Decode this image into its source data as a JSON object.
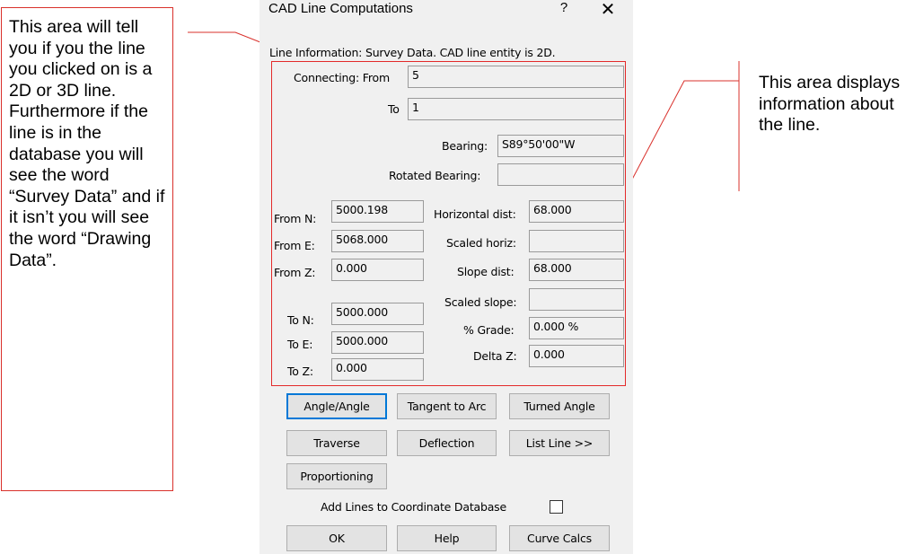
{
  "left_callout": {
    "text": "This area will tell you if you the line you clicked on is a 2D or 3D line. Furthermore if the line is in the database you will see the word “Survey Data” and if it isn’t you will see the word “Drawing Data”."
  },
  "right_callout": {
    "text": "This area displays information about the line."
  },
  "dialog": {
    "title": "CAD Line Computations",
    "help_glyph": "?",
    "close_glyph": "✕",
    "line_info": "Line Information: Survey Data. CAD line entity is 2D.",
    "connecting_from_label": "Connecting: From",
    "connecting_from_value": "5",
    "to_label": "To",
    "to_value": "1",
    "bearing_label": "Bearing:",
    "bearing_value": "S89°50'00\"W",
    "rotated_bearing_label": "Rotated Bearing:",
    "rotated_bearing_value": "",
    "from_n_label": "From N:",
    "from_n_value": "5000.198",
    "from_e_label": "From E:",
    "from_e_value": "5068.000",
    "from_z_label": "From Z:",
    "from_z_value": "0.000",
    "to_n_label": "To N:",
    "to_n_value": "5000.000",
    "to_e_label": "To E:",
    "to_e_value": "5000.000",
    "to_z_label": "To Z:",
    "to_z_value": "0.000",
    "horizontal_dist_label": "Horizontal dist:",
    "horizontal_dist_value": "68.000",
    "scaled_horiz_label": "Scaled horiz:",
    "scaled_horiz_value": "",
    "slope_dist_label": "Slope dist:",
    "slope_dist_value": "68.000",
    "scaled_slope_label": "Scaled slope:",
    "scaled_slope_value": "",
    "grade_label": "% Grade:",
    "grade_value": "0.000 %",
    "delta_z_label": "Delta Z:",
    "delta_z_value": "0.000",
    "buttons": {
      "angle_angle": "Angle/Angle",
      "tangent_to_arc": "Tangent to Arc",
      "turned_angle": "Turned Angle",
      "traverse": "Traverse",
      "deflection": "Deflection",
      "list_line": "List Line >>",
      "proportioning": "Proportioning",
      "ok": "OK",
      "help": "Help",
      "curve_calcs": "Curve Calcs"
    },
    "add_lines_label": "Add Lines to Coordinate Database",
    "add_lines_checked": false
  },
  "colors": {
    "callout_red": "#d9302b",
    "dialog_bg": "#f0f0f0",
    "default_button_border": "#0078d7"
  }
}
